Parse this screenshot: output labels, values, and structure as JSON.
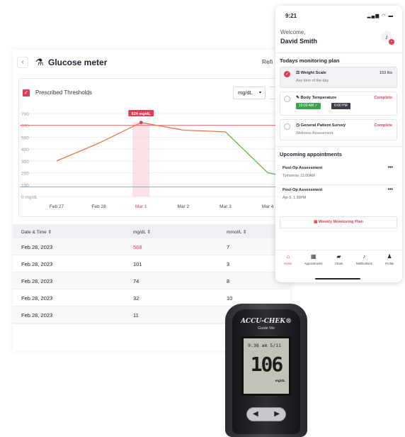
{
  "desktop": {
    "title": "Glucose meter",
    "back_label": "‹",
    "refresh_label": "Refi",
    "thresholds_label": "Prescribed Thresholds",
    "unit_selected": "mg/dL",
    "tooltip": "624 mg/dL",
    "end_label": "624",
    "table": {
      "headers": [
        "Date & Time ⇕",
        "mg/dL ⇕",
        "mmol/L ⇕"
      ],
      "rows": [
        [
          "Feb 28, 2023",
          "568",
          "7"
        ],
        [
          "Feb 28, 2023",
          "101",
          "3"
        ],
        [
          "Feb 28, 2023",
          "74",
          "8"
        ],
        [
          "Feb 28, 2023",
          "32",
          "10"
        ],
        [
          "Feb 28, 2023",
          "11",
          ""
        ]
      ]
    }
  },
  "chart_data": {
    "type": "line",
    "categories": [
      "Feb 27",
      "Feb 28",
      "Mar 1",
      "Mar 2",
      "Mar 3",
      "Mar 4"
    ],
    "y_ticks": [
      "700",
      "600",
      "500",
      "400",
      "300",
      "200",
      "100",
      "0 mg/dL"
    ],
    "ylim": [
      0,
      700
    ],
    "upper_threshold": 600,
    "lower_threshold": 80,
    "highlight_category": "Mar 1",
    "series": [
      {
        "x": [
          0,
          1,
          2,
          3,
          4,
          5,
          5.7
        ],
        "values": [
          300,
          450,
          624,
          560,
          545,
          200,
          150
        ],
        "color": "#e8744a"
      }
    ],
    "colors": {
      "line_start": "#e8744a",
      "line_end": "#5db340",
      "upper": "#e23c52",
      "lower": "#4aa3e0"
    },
    "grid": true
  },
  "phone": {
    "time": "9:21",
    "status_icons": "▂▄▆ ◠ ▬",
    "welcome": "Welcome,",
    "user": "David Smith",
    "plan_title": "Todays monitoring plan",
    "tasks": [
      {
        "name": "⚖ Weight Scale",
        "sub": "Any time of the day",
        "right": "153 lbs"
      },
      {
        "name": "✎ Body Temperature",
        "pill1": "10:00 AM ✓",
        "pill2": "6:00 PM",
        "right": "Complete"
      },
      {
        "name": "◷ General Patient Survey",
        "sub": "Wellness Assessment",
        "right": "Complete"
      }
    ],
    "appt_title": "Upcoming appointments",
    "appointments": [
      {
        "name": "Post-Op Assessment",
        "time": "Tomorrow, 11:00AM"
      },
      {
        "name": "Post-Op Assessment",
        "time": "Apr 5, 1:30PM"
      }
    ],
    "more": "•••",
    "weekly_btn": "▦  Weekly Monitoring Plan",
    "tabs": [
      {
        "icon": "⌂",
        "label": "Home"
      },
      {
        "icon": "▦",
        "label": "Appointments"
      },
      {
        "icon": "▰",
        "label": "Chats"
      },
      {
        "icon": "♪",
        "label": "Notifications"
      },
      {
        "icon": "♟",
        "label": "Profile"
      }
    ]
  },
  "meter": {
    "brand": "ACCU-CHEK®",
    "model": "Guide Me",
    "time": "9:38 am  5/11",
    "value": "106",
    "unit": "mg/dL",
    "left": "◀",
    "right": "▶"
  }
}
